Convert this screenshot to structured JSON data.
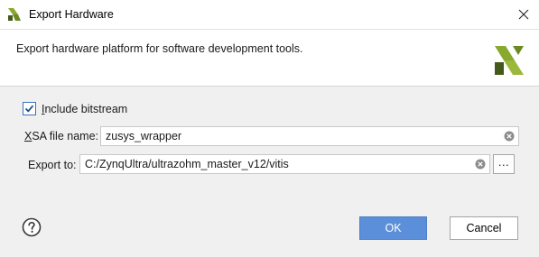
{
  "window": {
    "title": "Export Hardware"
  },
  "header": {
    "description": "Export hardware platform for software development tools."
  },
  "options": {
    "include_bitstream": {
      "label_mnemonic": "I",
      "label_rest": "nclude bitstream",
      "checked": true
    }
  },
  "fields": {
    "xsa_label_mnemonic": "X",
    "xsa_label_rest": "SA file name:",
    "xsa_value": "zusys_wrapper",
    "export_label": "Export to:",
    "export_value": "C:/ZynqUltra/ultrazohm_master_v12/vitis",
    "browse_label": "..."
  },
  "buttons": {
    "ok": "OK",
    "cancel": "Cancel"
  },
  "colors": {
    "accent": "#5b8fd9",
    "logo_green": "#88a82e",
    "logo_dark": "#45591a"
  }
}
